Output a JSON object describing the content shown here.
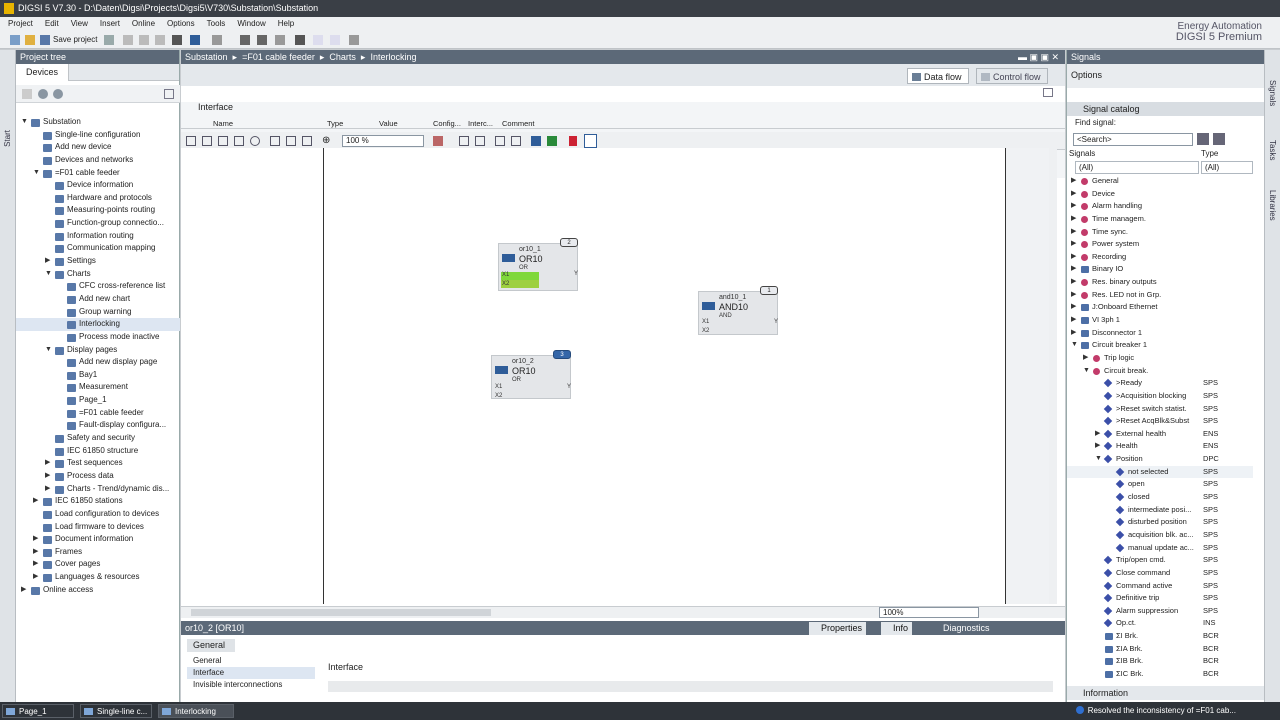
{
  "title": "DIGSI 5 V7.30 - D:\\Daten\\Digsi\\Projects\\Digsi5\\V730\\Substation\\Substation",
  "menu": [
    "Project",
    "Edit",
    "View",
    "Insert",
    "Online",
    "Options",
    "Tools",
    "Window",
    "Help"
  ],
  "toolbar": {
    "save_label": "Save project"
  },
  "brand": {
    "line1": "Energy Automation",
    "line2": "DIGSI 5 Premium"
  },
  "project_tree": {
    "header": "Project tree",
    "tab": "Devices",
    "items": [
      {
        "label": "Substation",
        "level": 0,
        "arrow": "▼"
      },
      {
        "label": "Single-line configuration",
        "level": 1,
        "arrow": ""
      },
      {
        "label": "Add new device",
        "level": 1,
        "arrow": ""
      },
      {
        "label": "Devices and networks",
        "level": 1,
        "arrow": ""
      },
      {
        "label": "=F01 cable feeder",
        "level": 1,
        "arrow": "▼"
      },
      {
        "label": "Device information",
        "level": 2,
        "arrow": ""
      },
      {
        "label": "Hardware and protocols",
        "level": 2,
        "arrow": ""
      },
      {
        "label": "Measuring-points routing",
        "level": 2,
        "arrow": ""
      },
      {
        "label": "Function-group connectio...",
        "level": 2,
        "arrow": ""
      },
      {
        "label": "Information routing",
        "level": 2,
        "arrow": ""
      },
      {
        "label": "Communication mapping",
        "level": 2,
        "arrow": ""
      },
      {
        "label": "Settings",
        "level": 2,
        "arrow": "▶"
      },
      {
        "label": "Charts",
        "level": 2,
        "arrow": "▼"
      },
      {
        "label": "CFC cross-reference list",
        "level": 3,
        "arrow": ""
      },
      {
        "label": "Add new chart",
        "level": 3,
        "arrow": ""
      },
      {
        "label": "Group warning",
        "level": 3,
        "arrow": ""
      },
      {
        "label": "Interlocking",
        "level": 3,
        "arrow": "",
        "sel": true
      },
      {
        "label": "Process mode inactive",
        "level": 3,
        "arrow": ""
      },
      {
        "label": "Display pages",
        "level": 2,
        "arrow": "▼"
      },
      {
        "label": "Add new display page",
        "level": 3,
        "arrow": ""
      },
      {
        "label": "Bay1",
        "level": 3,
        "arrow": ""
      },
      {
        "label": "Measurement",
        "level": 3,
        "arrow": ""
      },
      {
        "label": "Page_1",
        "level": 3,
        "arrow": ""
      },
      {
        "label": "=F01 cable feeder",
        "level": 3,
        "arrow": ""
      },
      {
        "label": "Fault-display configura...",
        "level": 3,
        "arrow": ""
      },
      {
        "label": "Safety and security",
        "level": 2,
        "arrow": ""
      },
      {
        "label": "IEC 61850 structure",
        "level": 2,
        "arrow": ""
      },
      {
        "label": "Test sequences",
        "level": 2,
        "arrow": "▶"
      },
      {
        "label": "Process data",
        "level": 2,
        "arrow": "▶"
      },
      {
        "label": "Charts - Trend/dynamic dis...",
        "level": 2,
        "arrow": "▶"
      },
      {
        "label": "IEC 61850 stations",
        "level": 1,
        "arrow": "▶"
      },
      {
        "label": "Load configuration to devices",
        "level": 1,
        "arrow": ""
      },
      {
        "label": "Load firmware to devices",
        "level": 1,
        "arrow": ""
      },
      {
        "label": "Document information",
        "level": 1,
        "arrow": "▶"
      },
      {
        "label": "Frames",
        "level": 1,
        "arrow": "▶"
      },
      {
        "label": "Cover pages",
        "level": 1,
        "arrow": "▶"
      },
      {
        "label": "Languages & resources",
        "level": 1,
        "arrow": "▶"
      },
      {
        "label": "Online access",
        "level": 0,
        "arrow": "▶"
      }
    ]
  },
  "breadcrumb": [
    "Substation",
    "=F01 cable feeder",
    "Charts",
    "Interlocking"
  ],
  "view_tabs": {
    "data_flow": "Data flow",
    "control_flow": "Control flow"
  },
  "interface": {
    "title": "Interface",
    "columns": [
      "Name",
      "Type",
      "Value",
      "Config...",
      "Interc...",
      "Comment"
    ]
  },
  "zoom": "100 %",
  "zoom_bottom": "100%",
  "blocks": [
    {
      "name": "or10_1",
      "type": "OR10",
      "sub": "OR",
      "badge": "2",
      "pins": [
        "X1",
        "X2"
      ],
      "out": "Y",
      "badge_blue": false
    },
    {
      "name": "and10_1",
      "type": "AND10",
      "sub": "AND",
      "badge": "1",
      "pins": [
        "X1",
        "X2"
      ],
      "out": "Y",
      "badge_blue": false
    },
    {
      "name": "or10_2",
      "type": "OR10",
      "sub": "OR",
      "badge": "3",
      "pins": [
        "X1",
        "X2"
      ],
      "out": "Y",
      "badge_blue": true
    }
  ],
  "properties": {
    "object": "or10_2 [OR10]",
    "tabs": [
      "Properties",
      "Info",
      "Diagnostics"
    ],
    "general_tab": "General",
    "nav": [
      "General",
      "Interface",
      "Invisible interconnections"
    ],
    "section": "Interface"
  },
  "signals": {
    "header": "Signals",
    "options": "Options",
    "catalog": "Signal catalog",
    "find_label": "Find signal:",
    "search_placeholder": "<Search>",
    "col_signals": "Signals",
    "col_type": "Type",
    "filter_all": "(All)",
    "filter_type": "(All)",
    "items": [
      {
        "label": "General",
        "level": 0,
        "arrow": "▶",
        "icon": "dot",
        "type": ""
      },
      {
        "label": "Device",
        "level": 0,
        "arrow": "▶",
        "icon": "dot",
        "type": ""
      },
      {
        "label": "Alarm handling",
        "level": 0,
        "arrow": "▶",
        "icon": "dot",
        "type": ""
      },
      {
        "label": "Time managem.",
        "level": 0,
        "arrow": "▶",
        "icon": "dot",
        "type": ""
      },
      {
        "label": "Time sync.",
        "level": 0,
        "arrow": "▶",
        "icon": "dot",
        "type": ""
      },
      {
        "label": "Power system",
        "level": 0,
        "arrow": "▶",
        "icon": "dot",
        "type": ""
      },
      {
        "label": "Recording",
        "level": 0,
        "arrow": "▶",
        "icon": "dot",
        "type": ""
      },
      {
        "label": "Binary IO",
        "level": 0,
        "arrow": "▶",
        "icon": "box",
        "type": ""
      },
      {
        "label": "Res. binary outputs",
        "level": 0,
        "arrow": "▶",
        "icon": "dot",
        "type": ""
      },
      {
        "label": "Res. LED not in Grp.",
        "level": 0,
        "arrow": "▶",
        "icon": "dot",
        "type": ""
      },
      {
        "label": "J:Onboard Ethernet",
        "level": 0,
        "arrow": "▶",
        "icon": "box",
        "type": ""
      },
      {
        "label": "VI 3ph 1",
        "level": 0,
        "arrow": "▶",
        "icon": "box",
        "type": ""
      },
      {
        "label": "Disconnector 1",
        "level": 0,
        "arrow": "▶",
        "icon": "box",
        "type": ""
      },
      {
        "label": "Circuit breaker 1",
        "level": 0,
        "arrow": "▼",
        "icon": "box",
        "type": ""
      },
      {
        "label": "Trip logic",
        "level": 1,
        "arrow": "▶",
        "icon": "dot",
        "type": ""
      },
      {
        "label": "Circuit break.",
        "level": 1,
        "arrow": "▼",
        "icon": "dot",
        "type": ""
      },
      {
        "label": ">Ready",
        "level": 2,
        "arrow": "",
        "icon": "dia",
        "type": "SPS"
      },
      {
        "label": ">Acquisition blocking",
        "level": 2,
        "arrow": "",
        "icon": "dia",
        "type": "SPS"
      },
      {
        "label": ">Reset switch statist.",
        "level": 2,
        "arrow": "",
        "icon": "dia",
        "type": "SPS"
      },
      {
        "label": ">Reset AcqBlk&Subst",
        "level": 2,
        "arrow": "",
        "icon": "dia",
        "type": "SPS"
      },
      {
        "label": "External health",
        "level": 2,
        "arrow": "▶",
        "icon": "dia",
        "type": "ENS"
      },
      {
        "label": "Health",
        "level": 2,
        "arrow": "▶",
        "icon": "dia",
        "type": "ENS"
      },
      {
        "label": "Position",
        "level": 2,
        "arrow": "▼",
        "icon": "dia",
        "type": "DPC"
      },
      {
        "label": "not selected",
        "level": 3,
        "arrow": "",
        "icon": "dia",
        "type": "SPS",
        "sel": true
      },
      {
        "label": "open",
        "level": 3,
        "arrow": "",
        "icon": "dia",
        "type": "SPS"
      },
      {
        "label": "closed",
        "level": 3,
        "arrow": "",
        "icon": "dia",
        "type": "SPS"
      },
      {
        "label": "intermediate posi...",
        "level": 3,
        "arrow": "",
        "icon": "dia",
        "type": "SPS"
      },
      {
        "label": "disturbed position",
        "level": 3,
        "arrow": "",
        "icon": "dia",
        "type": "SPS"
      },
      {
        "label": "acquisition blk. ac...",
        "level": 3,
        "arrow": "",
        "icon": "dia",
        "type": "SPS"
      },
      {
        "label": "manual update ac...",
        "level": 3,
        "arrow": "",
        "icon": "dia",
        "type": "SPS"
      },
      {
        "label": "Trip/open cmd.",
        "level": 2,
        "arrow": "",
        "icon": "dia",
        "type": "SPS"
      },
      {
        "label": "Close command",
        "level": 2,
        "arrow": "",
        "icon": "dia",
        "type": "SPS"
      },
      {
        "label": "Command active",
        "level": 2,
        "arrow": "",
        "icon": "dia",
        "type": "SPS"
      },
      {
        "label": "Definitive trip",
        "level": 2,
        "arrow": "",
        "icon": "dia",
        "type": "SPS"
      },
      {
        "label": "Alarm suppression",
        "level": 2,
        "arrow": "",
        "icon": "dia",
        "type": "SPS"
      },
      {
        "label": "Op.ct.",
        "level": 2,
        "arrow": "",
        "icon": "dia",
        "type": "INS"
      },
      {
        "label": "ΣI Brk.",
        "level": 2,
        "arrow": "",
        "icon": "box",
        "type": "BCR"
      },
      {
        "label": "ΣIA Brk.",
        "level": 2,
        "arrow": "",
        "icon": "box",
        "type": "BCR"
      },
      {
        "label": "ΣIB Brk.",
        "level": 2,
        "arrow": "",
        "icon": "box",
        "type": "BCR"
      },
      {
        "label": "ΣIC Brk.",
        "level": 2,
        "arrow": "",
        "icon": "box",
        "type": "BCR"
      }
    ],
    "information": "Information"
  },
  "side_labels": {
    "left": "Start",
    "right": [
      "Signals",
      "Tasks",
      "Libraries"
    ]
  },
  "taskbar": [
    {
      "label": "Page_1"
    },
    {
      "label": "Single-line c..."
    },
    {
      "label": "Interlocking",
      "active": true
    }
  ],
  "status": "Resolved the inconsistency of =F01 cab..."
}
